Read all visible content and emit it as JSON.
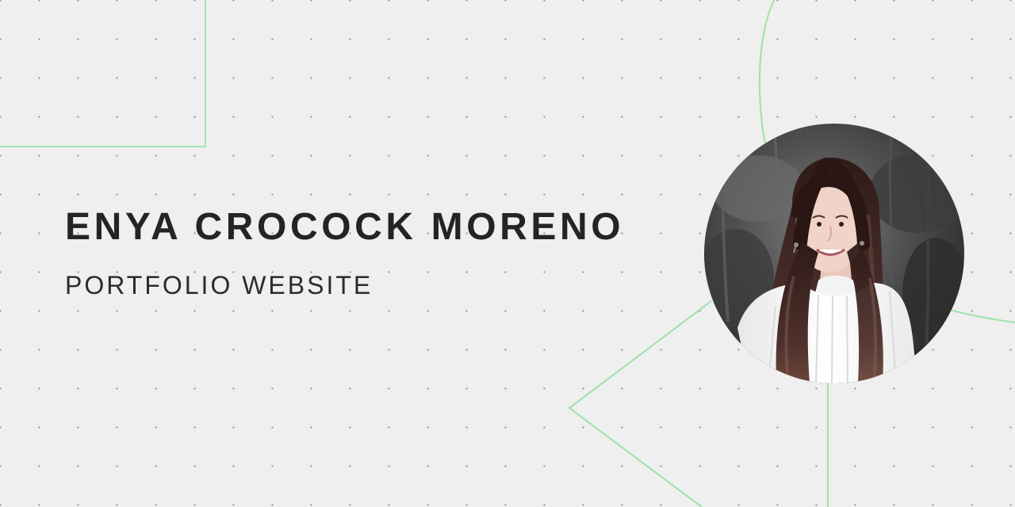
{
  "hero": {
    "name": "ENYA CROCOCK MORENO",
    "subtitle": "PORTFOLIO WEBSITE"
  },
  "colors": {
    "background": "#efefef",
    "accent_lines": "#8fe0a4",
    "text": "#242424"
  }
}
